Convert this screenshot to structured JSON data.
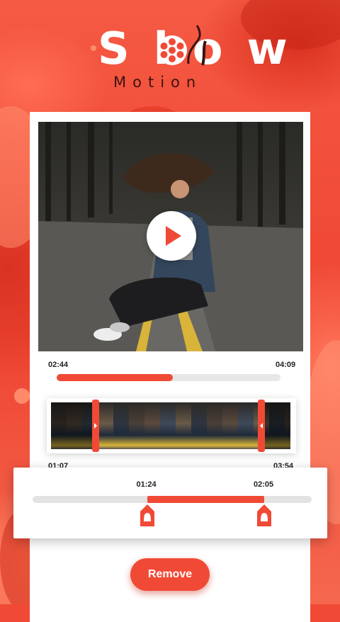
{
  "app": {
    "logo_title": "Slow",
    "logo_subtitle": "Motion"
  },
  "player": {
    "state_icon": "play-icon",
    "current_time": "02:44",
    "total_time": "04:09",
    "progress": 0.52
  },
  "trim": {
    "strip_start_time": "01:07",
    "strip_end_time": "03:54",
    "start_label": "01:24",
    "end_label": "02:05",
    "range_start": 0.41,
    "range_end": 0.83
  },
  "actions": {
    "remove_label": "Remove"
  },
  "colors": {
    "accent": "#f04a36",
    "background": "#ee4432",
    "card": "#ffffff",
    "track": "#e3e3e3"
  }
}
